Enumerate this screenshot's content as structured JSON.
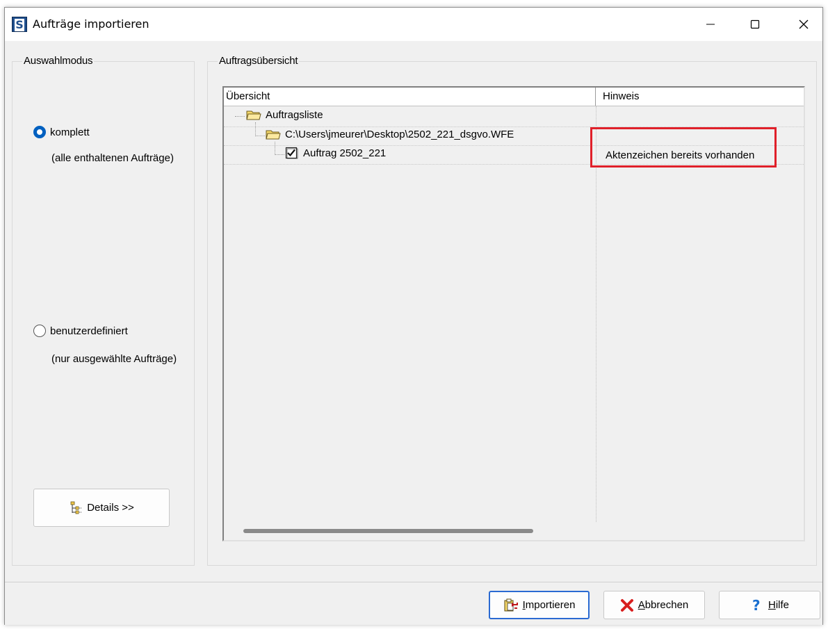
{
  "window": {
    "app_icon_letter": "S",
    "title": "Aufträge importieren"
  },
  "left_group": {
    "title": "Auswahlmodus",
    "options": [
      {
        "label": "komplett",
        "description": "(alle enthaltenen Aufträge)",
        "checked": true
      },
      {
        "label": "benutzerdefiniert",
        "description": "(nur ausgewählte Aufträge)",
        "checked": false
      }
    ],
    "details_button": "Details >>"
  },
  "right_group": {
    "title": "Auftragsübersicht",
    "columns": [
      "Übersicht",
      "Hinweis"
    ],
    "tree": [
      {
        "label": "Auftragsliste",
        "icon": "folder-icon",
        "hint": ""
      },
      {
        "label": "C:\\Users\\jmeurer\\Desktop\\2502_221_dsgvo.WFE",
        "icon": "folder-icon",
        "hint": ""
      },
      {
        "label": "Auftrag 2502_221",
        "icon": "checked-checkbox-icon",
        "hint": "Aktenzeichen bereits vorhanden"
      }
    ]
  },
  "buttons": {
    "import": {
      "mnemonic": "I",
      "rest": "mportieren"
    },
    "cancel": {
      "mnemonic": "A",
      "rest": "bbrechen"
    },
    "help": {
      "mnemonic": "H",
      "rest": "ilfe"
    }
  },
  "colors": {
    "highlight": "#e0202a",
    "radio_accent": "#0060c0",
    "cancel_icon": "#d81e1e",
    "help_icon": "#1a6fd0"
  }
}
